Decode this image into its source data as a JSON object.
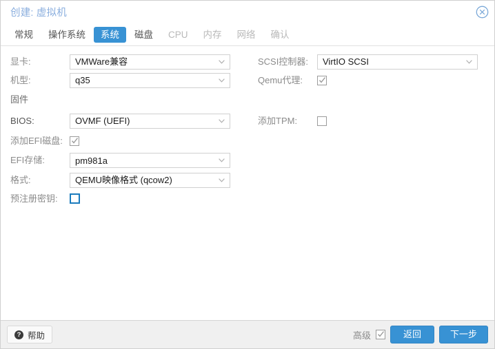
{
  "window": {
    "title": "创建: 虚拟机",
    "close_icon": "close-circle-icon"
  },
  "tabs": [
    {
      "label": "常规",
      "state": "enabled"
    },
    {
      "label": "操作系统",
      "state": "enabled"
    },
    {
      "label": "系统",
      "state": "active"
    },
    {
      "label": "磁盘",
      "state": "enabled"
    },
    {
      "label": "CPU",
      "state": "disabled"
    },
    {
      "label": "内存",
      "state": "disabled"
    },
    {
      "label": "网络",
      "state": "disabled"
    },
    {
      "label": "确认",
      "state": "disabled"
    }
  ],
  "form": {
    "left": {
      "graphic_card": {
        "label": "显卡:",
        "value": "VMWare兼容"
      },
      "machine": {
        "label": "机型:",
        "value": "q35"
      },
      "firmware_hdr": {
        "label": "固件"
      },
      "bios": {
        "label": "BIOS:",
        "value": "OVMF (UEFI)"
      },
      "add_efi_disk": {
        "label": "添加EFI磁盘:",
        "checked": true
      },
      "efi_storage": {
        "label": "EFI存储:",
        "value": "pm981a"
      },
      "format": {
        "label": "格式:",
        "value": "QEMU映像格式 (qcow2)"
      },
      "pre_enroll_keys": {
        "label": "预注册密钥:",
        "checked": false
      }
    },
    "right": {
      "scsi_controller": {
        "label": "SCSI控制器:",
        "value": "VirtIO SCSI"
      },
      "qemu_agent": {
        "label": "Qemu代理:",
        "checked": true
      },
      "add_tpm": {
        "label": "添加TPM:",
        "checked": false
      }
    }
  },
  "footer": {
    "help_label": "帮助",
    "help_icon": "question-mark-icon",
    "advanced_label": "高级",
    "advanced_checked": true,
    "back_label": "返回",
    "next_label": "下一步"
  },
  "colors": {
    "accent": "#3892d4",
    "title": "#8aaede",
    "label": "#8b8b8b",
    "footer_bg": "#f0f0f0"
  }
}
